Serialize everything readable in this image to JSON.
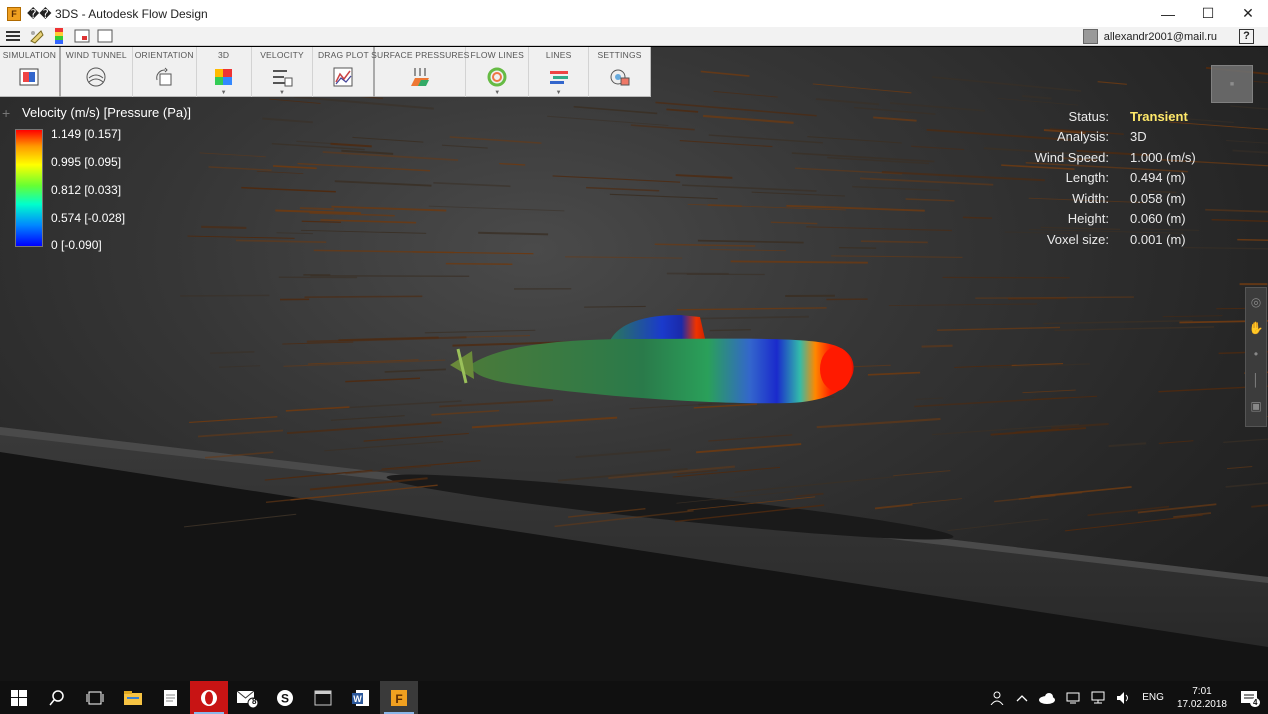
{
  "window": {
    "title": "�� 3DS - Autodesk Flow Design",
    "minimize": "—",
    "maximize": "☐",
    "close": "✕"
  },
  "account": {
    "email": "allexandr2001@mail.ru",
    "help": "?"
  },
  "ribbon": {
    "tabs": [
      {
        "label": "SIMULATION",
        "icon": "simulation-icon"
      },
      {
        "label": "WIND TUNNEL",
        "icon": "wind-tunnel-icon"
      },
      {
        "label": "ORIENTATION",
        "icon": "orientation-icon"
      },
      {
        "label": "3D",
        "icon": "3d-view-icon",
        "dropdown": true
      },
      {
        "label": "VELOCITY",
        "icon": "velocity-icon",
        "dropdown": true
      },
      {
        "label": "DRAG PLOT",
        "icon": "drag-plot-icon"
      },
      {
        "label": "SURFACE PRESSURES",
        "icon": "surface-pressures-icon"
      },
      {
        "label": "FLOW LINES",
        "icon": "flow-lines-icon",
        "dropdown": true
      },
      {
        "label": "LINES",
        "icon": "lines-icon",
        "dropdown": true
      },
      {
        "label": "SETTINGS",
        "icon": "settings-icon"
      }
    ]
  },
  "legend": {
    "title": "Velocity (m/s) [Pressure (Pa)]",
    "ticks": [
      "1.149 [0.157]",
      "0.995 [0.095]",
      "0.812 [0.033]",
      "0.574 [-0.028]",
      "0 [-0.090]"
    ],
    "colors": [
      "#ff0000",
      "#ff9900",
      "#ffff00",
      "#66ff33",
      "#00ffcc",
      "#0088ff",
      "#0000ff"
    ]
  },
  "status": {
    "rows": [
      {
        "label": "Status:",
        "value": "Transient",
        "highlight": true
      },
      {
        "label": "Analysis:",
        "value": "3D"
      },
      {
        "label": "Wind Speed:",
        "value": "1.000 (m/s)"
      },
      {
        "label": "Length:",
        "value": "0.494 (m)"
      },
      {
        "label": "Width:",
        "value": "0.058 (m)"
      },
      {
        "label": "Height:",
        "value": "0.060 (m)"
      },
      {
        "label": "Voxel size:",
        "value": "0.001 (m)"
      }
    ]
  },
  "taskbar": {
    "apps": [
      "start-icon",
      "search-icon",
      "task-view-icon",
      "file-explorer-icon",
      "notepad-icon",
      "opera-icon",
      "mail-icon",
      "skype-icon",
      "terminal-icon",
      "word-icon",
      "flow-design-icon"
    ],
    "mail_badge": "8",
    "language": "ENG",
    "time": "7:01",
    "date": "17.02.2018",
    "notification_count": "4"
  }
}
